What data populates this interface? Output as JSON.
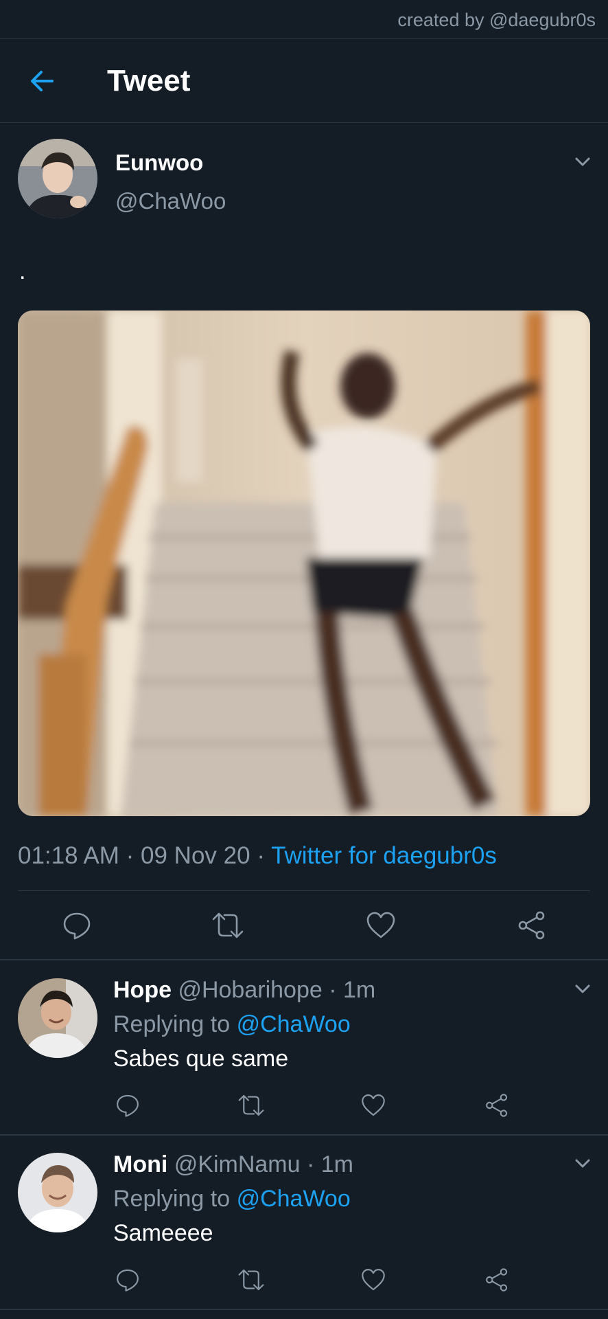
{
  "watermark": "created by @daegubr0s",
  "header": {
    "title": "Tweet",
    "back_icon": "arrow-left-icon"
  },
  "colors": {
    "background": "#141d26",
    "accent": "#1da1f2",
    "muted": "#8b98a5",
    "divider": "#2a3642"
  },
  "tweet": {
    "name": "Eunwoo",
    "handle": "@ChaWoo",
    "text": ".",
    "time": "01:18 AM",
    "sep1": "·",
    "date": "09 Nov 20",
    "sep2": "·",
    "source": "Twitter for daegubr0s"
  },
  "actions": [
    "reply-icon",
    "retweet-icon",
    "like-icon",
    "share-icon"
  ],
  "replies": [
    {
      "name": "Hope",
      "handle": "@Hobarihope",
      "time": "· 1m",
      "replying_prefix": "Replying to",
      "replying_to": "@ChaWoo",
      "text": "Sabes que same"
    },
    {
      "name": "Moni",
      "handle": "@KimNamu",
      "time": "· 1m",
      "replying_prefix": "Replying to",
      "replying_to": "@ChaWoo",
      "text": "Sameeee"
    }
  ]
}
